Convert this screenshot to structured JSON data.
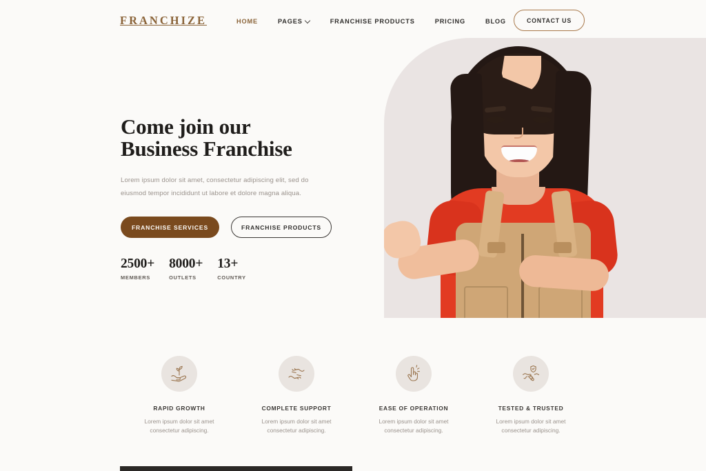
{
  "brand": {
    "name": "FRANCHIZE"
  },
  "nav": {
    "items": [
      {
        "label": "HOME",
        "active": true,
        "has_dropdown": false
      },
      {
        "label": "PAGES",
        "active": false,
        "has_dropdown": true
      },
      {
        "label": "FRANCHISE PRODUCTS",
        "active": false,
        "has_dropdown": false
      },
      {
        "label": "PRICING",
        "active": false,
        "has_dropdown": false
      },
      {
        "label": "BLOG",
        "active": false,
        "has_dropdown": false
      }
    ],
    "contact_label": "CONTACT US"
  },
  "hero": {
    "title_line1": "Come join our",
    "title_line2": "Business Franchise",
    "subtitle": "Lorem ipsum dolor sit amet, consectetur adipiscing elit, sed do eiusmod tempor incididunt ut labore et dolore magna aliqua.",
    "primary_button": "FRANCHISE SERVICES",
    "secondary_button": "FRANCHISE PRODUCTS",
    "image_alt": "Smiling young woman in red t-shirt and tan overalls"
  },
  "stats": [
    {
      "value": "2500+",
      "label": "MEMBERS"
    },
    {
      "value": "8000+",
      "label": "OUTLETS"
    },
    {
      "value": "13+",
      "label": "COUNTRY"
    }
  ],
  "features": [
    {
      "icon": "hand-holding-sprout-icon",
      "title": "RAPID GROWTH",
      "desc": "Lorem ipsum dolor sit amet consectetur adipiscing."
    },
    {
      "icon": "helping-hands-icon",
      "title": "COMPLETE SUPPORT",
      "desc": "Lorem ipsum dolor sit amet consectetur adipiscing."
    },
    {
      "icon": "snapping-fingers-icon",
      "title": "EASE OF OPERATION",
      "desc": "Lorem ipsum dolor sit amet consectetur adipiscing."
    },
    {
      "icon": "handshake-shield-icon",
      "title": "TESTED & TRUSTED",
      "desc": "Lorem ipsum dolor sit amet consectetur adipiscing."
    }
  ],
  "colors": {
    "page_background": "#fbfaf8",
    "brand_brown": "#8a6338",
    "button_brown": "#7a4a1e",
    "hero_panel": "#eae4e3",
    "icon_circle": "#e9e4e0",
    "heading_dark": "#1f1d1b",
    "muted_text": "#9a928c",
    "shirt_red": "#e23b22",
    "overalls_tan": "#cfa676",
    "bottom_strip": "#2b2826"
  }
}
